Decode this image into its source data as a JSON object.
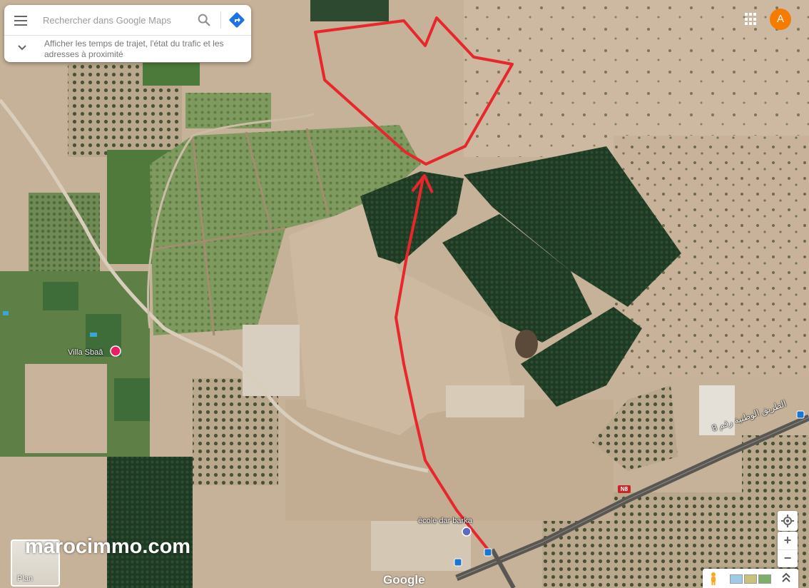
{
  "search": {
    "placeholder": "Rechercher dans Google Maps",
    "expand_text": "Afficher les temps de trajet, l'état du trafic et les adresses à proximité"
  },
  "account": {
    "avatar_letter": "A",
    "avatar_color": "#f57c00"
  },
  "map": {
    "labels": {
      "villa": "Villa Sbaâ",
      "ecole": "ècole dar barka",
      "road_name": "الطريق الوطنية رقم 8",
      "road_shield": "N8"
    },
    "google_logo": "Google",
    "plan_label": "Plan",
    "watermark": "marocimmo.com"
  },
  "annotation_color": "#e8262c",
  "controls": {
    "zoom_in": "+",
    "zoom_out": "−"
  },
  "icons": [
    "menu-icon",
    "search-icon",
    "directions-icon",
    "chevron-down-icon",
    "apps-grid-icon",
    "locate-icon",
    "pegman-icon",
    "chevron-up-icon"
  ]
}
